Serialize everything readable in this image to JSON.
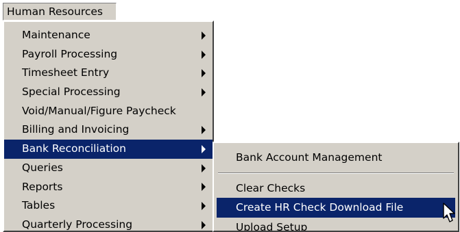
{
  "menubar": {
    "title": "Human Resources"
  },
  "main_menu": {
    "items": [
      {
        "label": "Maintenance"
      },
      {
        "label": "Payroll Processing"
      },
      {
        "label": "Timesheet Entry"
      },
      {
        "label": "Special Processing"
      },
      {
        "label": "Void/Manual/Figure Paycheck"
      },
      {
        "label": "Billing and Invoicing"
      },
      {
        "label": "Bank Reconciliation"
      },
      {
        "label": "Queries"
      },
      {
        "label": "Reports"
      },
      {
        "label": "Tables"
      },
      {
        "label": "Quarterly Processing"
      }
    ]
  },
  "sub_menu": {
    "items": [
      {
        "label": "Bank Account Management"
      },
      {
        "label": "Clear Checks"
      },
      {
        "label": "Create HR Check Download File"
      },
      {
        "label": "Upload Setup"
      }
    ]
  },
  "colors": {
    "menu_background": "#d4d0c8",
    "highlight": "#0a246a",
    "highlight_text": "#ffffff"
  },
  "icons": {
    "submenu_arrow": "chevron-right-icon",
    "cursor": "mouse-pointer-icon"
  }
}
